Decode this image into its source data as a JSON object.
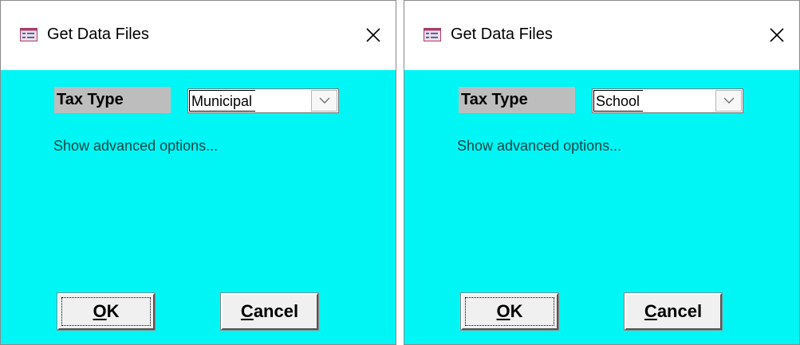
{
  "dialogs": [
    {
      "title": "Get Data Files",
      "field_label": "Tax Type",
      "tax_type_value": "Municipal",
      "advanced_link": "Show advanced options...",
      "ok_access_key": "O",
      "ok_rest": "K",
      "cancel_access_key": "C",
      "cancel_rest": "ancel"
    },
    {
      "title": "Get Data Files",
      "field_label": "Tax Type",
      "tax_type_value": "School",
      "advanced_link": "Show advanced options...",
      "ok_access_key": "O",
      "ok_rest": "K",
      "cancel_access_key": "C",
      "cancel_rest": "ancel"
    }
  ],
  "colors": {
    "client_background": "#00f5f5",
    "label_background": "#bdbdbd",
    "link_text": "#1c4444"
  },
  "icons": {
    "app": "form-window-icon",
    "close": "close-icon",
    "dropdown": "chevron-down-icon"
  }
}
